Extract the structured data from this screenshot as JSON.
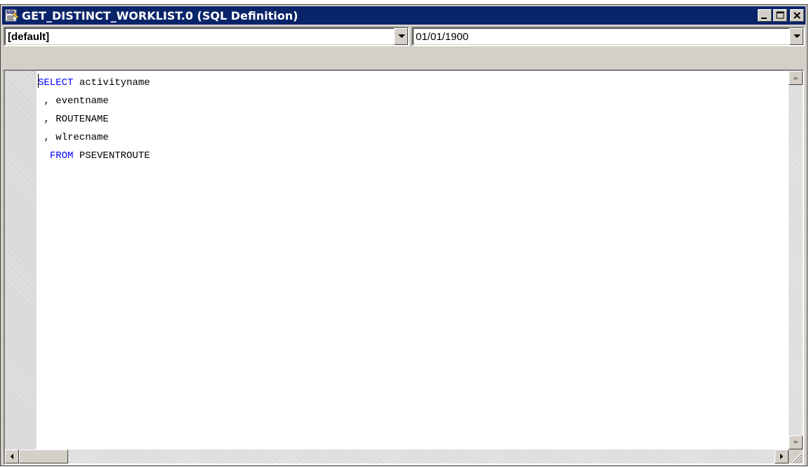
{
  "window": {
    "title": "GET_DISTINCT_WORKLIST.0 (SQL Definition)",
    "icon": "sql-definition-icon"
  },
  "toolbar": {
    "database_type": "[default]",
    "effective_date": "01/01/1900"
  },
  "editor": {
    "lines": [
      {
        "keyword": "SELECT",
        "text": " activityname"
      },
      {
        "keyword": "",
        "text": " , eventname"
      },
      {
        "keyword": "",
        "text": " , ROUTENAME"
      },
      {
        "keyword": "",
        "text": " , wlrecname"
      },
      {
        "keyword": "FROM",
        "text": " PSEVENTROUTE"
      }
    ]
  },
  "colors": {
    "titlebar": "#0a246a",
    "keyword": "#0000ff",
    "chrome": "#d4d0c8"
  }
}
